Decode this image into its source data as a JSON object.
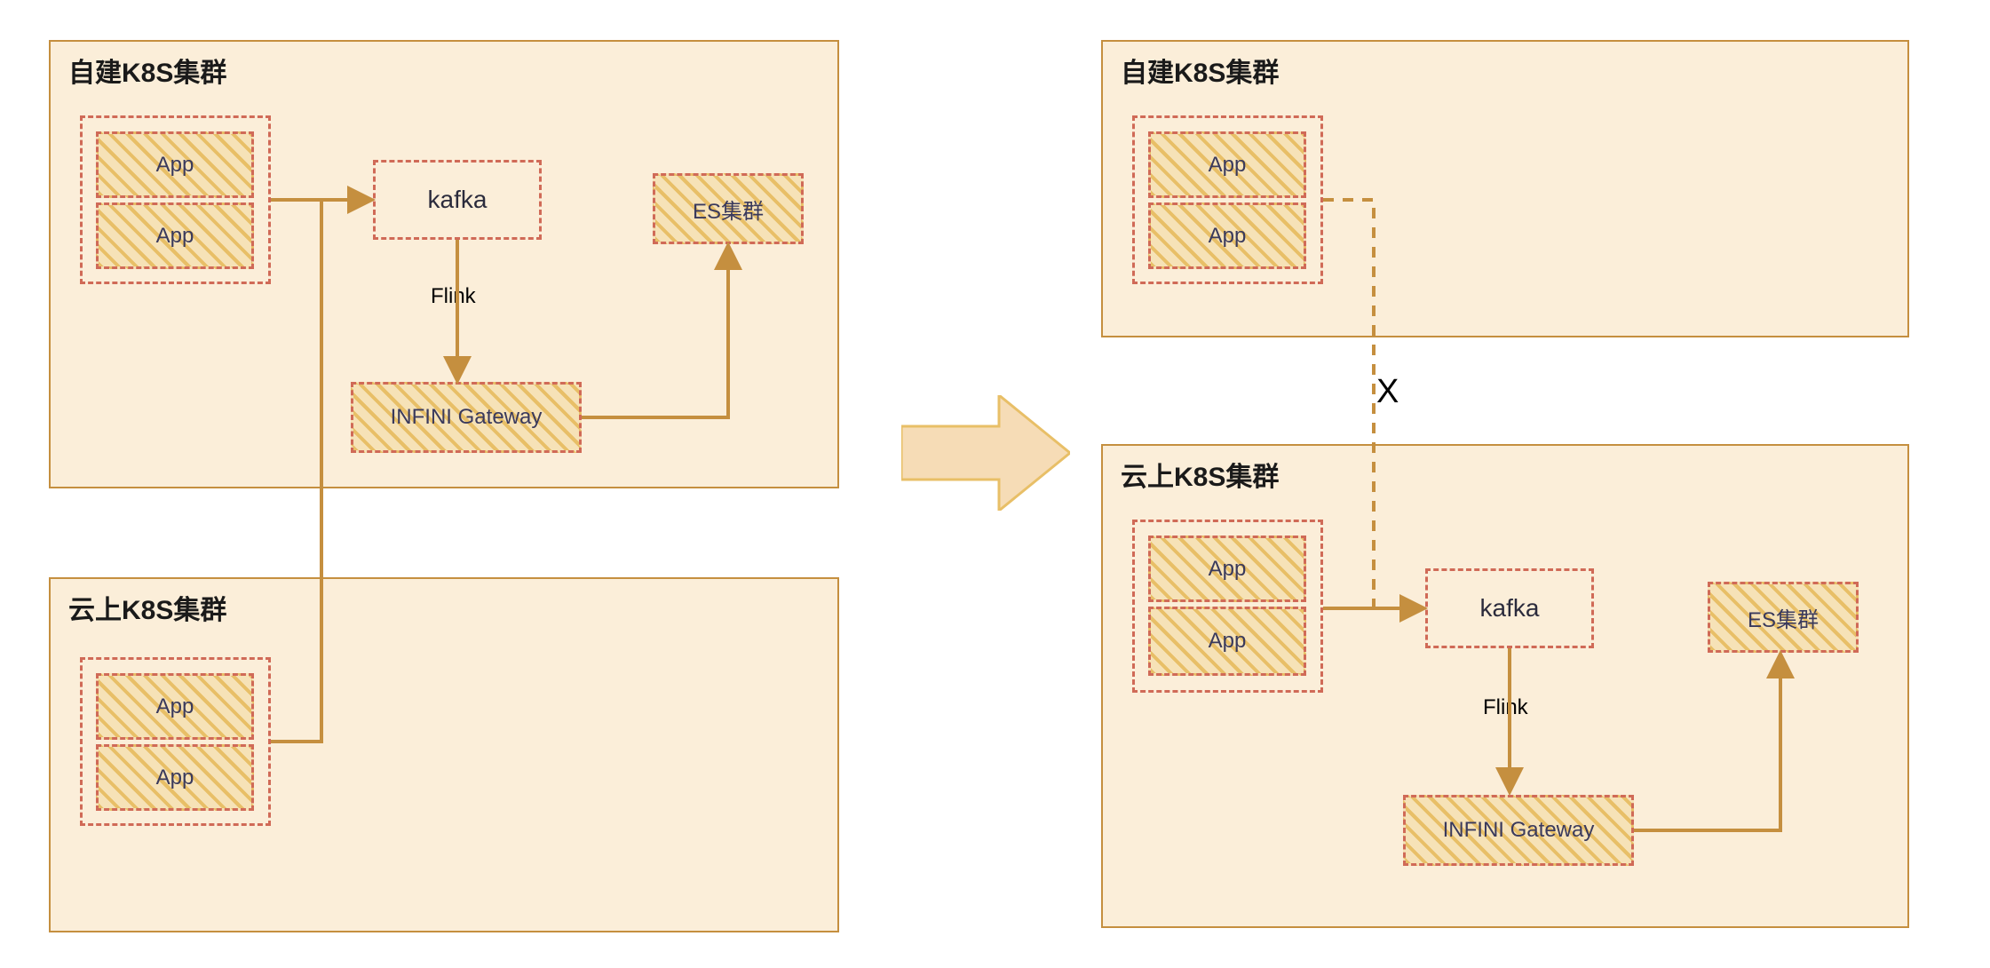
{
  "left": {
    "top_cluster_title": "自建K8S集群",
    "bottom_cluster_title": "云上K8S集群",
    "app_label": "App",
    "kafka_label": "kafka",
    "flink_label": "Flink",
    "gateway_label": "INFINI Gateway",
    "es_label": "ES集群"
  },
  "right": {
    "top_cluster_title": "自建K8S集群",
    "bottom_cluster_title": "云上K8S集群",
    "app_label": "App",
    "kafka_label": "kafka",
    "flink_label": "Flink",
    "gateway_label": "INFINI Gateway",
    "es_label": "ES集群",
    "break_label": "X"
  },
  "colors": {
    "cluster_fill": "#fbeed9",
    "cluster_border": "#c58f3f",
    "dashed_border": "#d06a57",
    "hatch_light": "#f6e2b7",
    "hatch_dark": "#e8bf67",
    "arrow": "#c58f3f",
    "bigarrow_fill": "#f6dcb6",
    "bigarrow_stroke": "#e8bf67"
  }
}
